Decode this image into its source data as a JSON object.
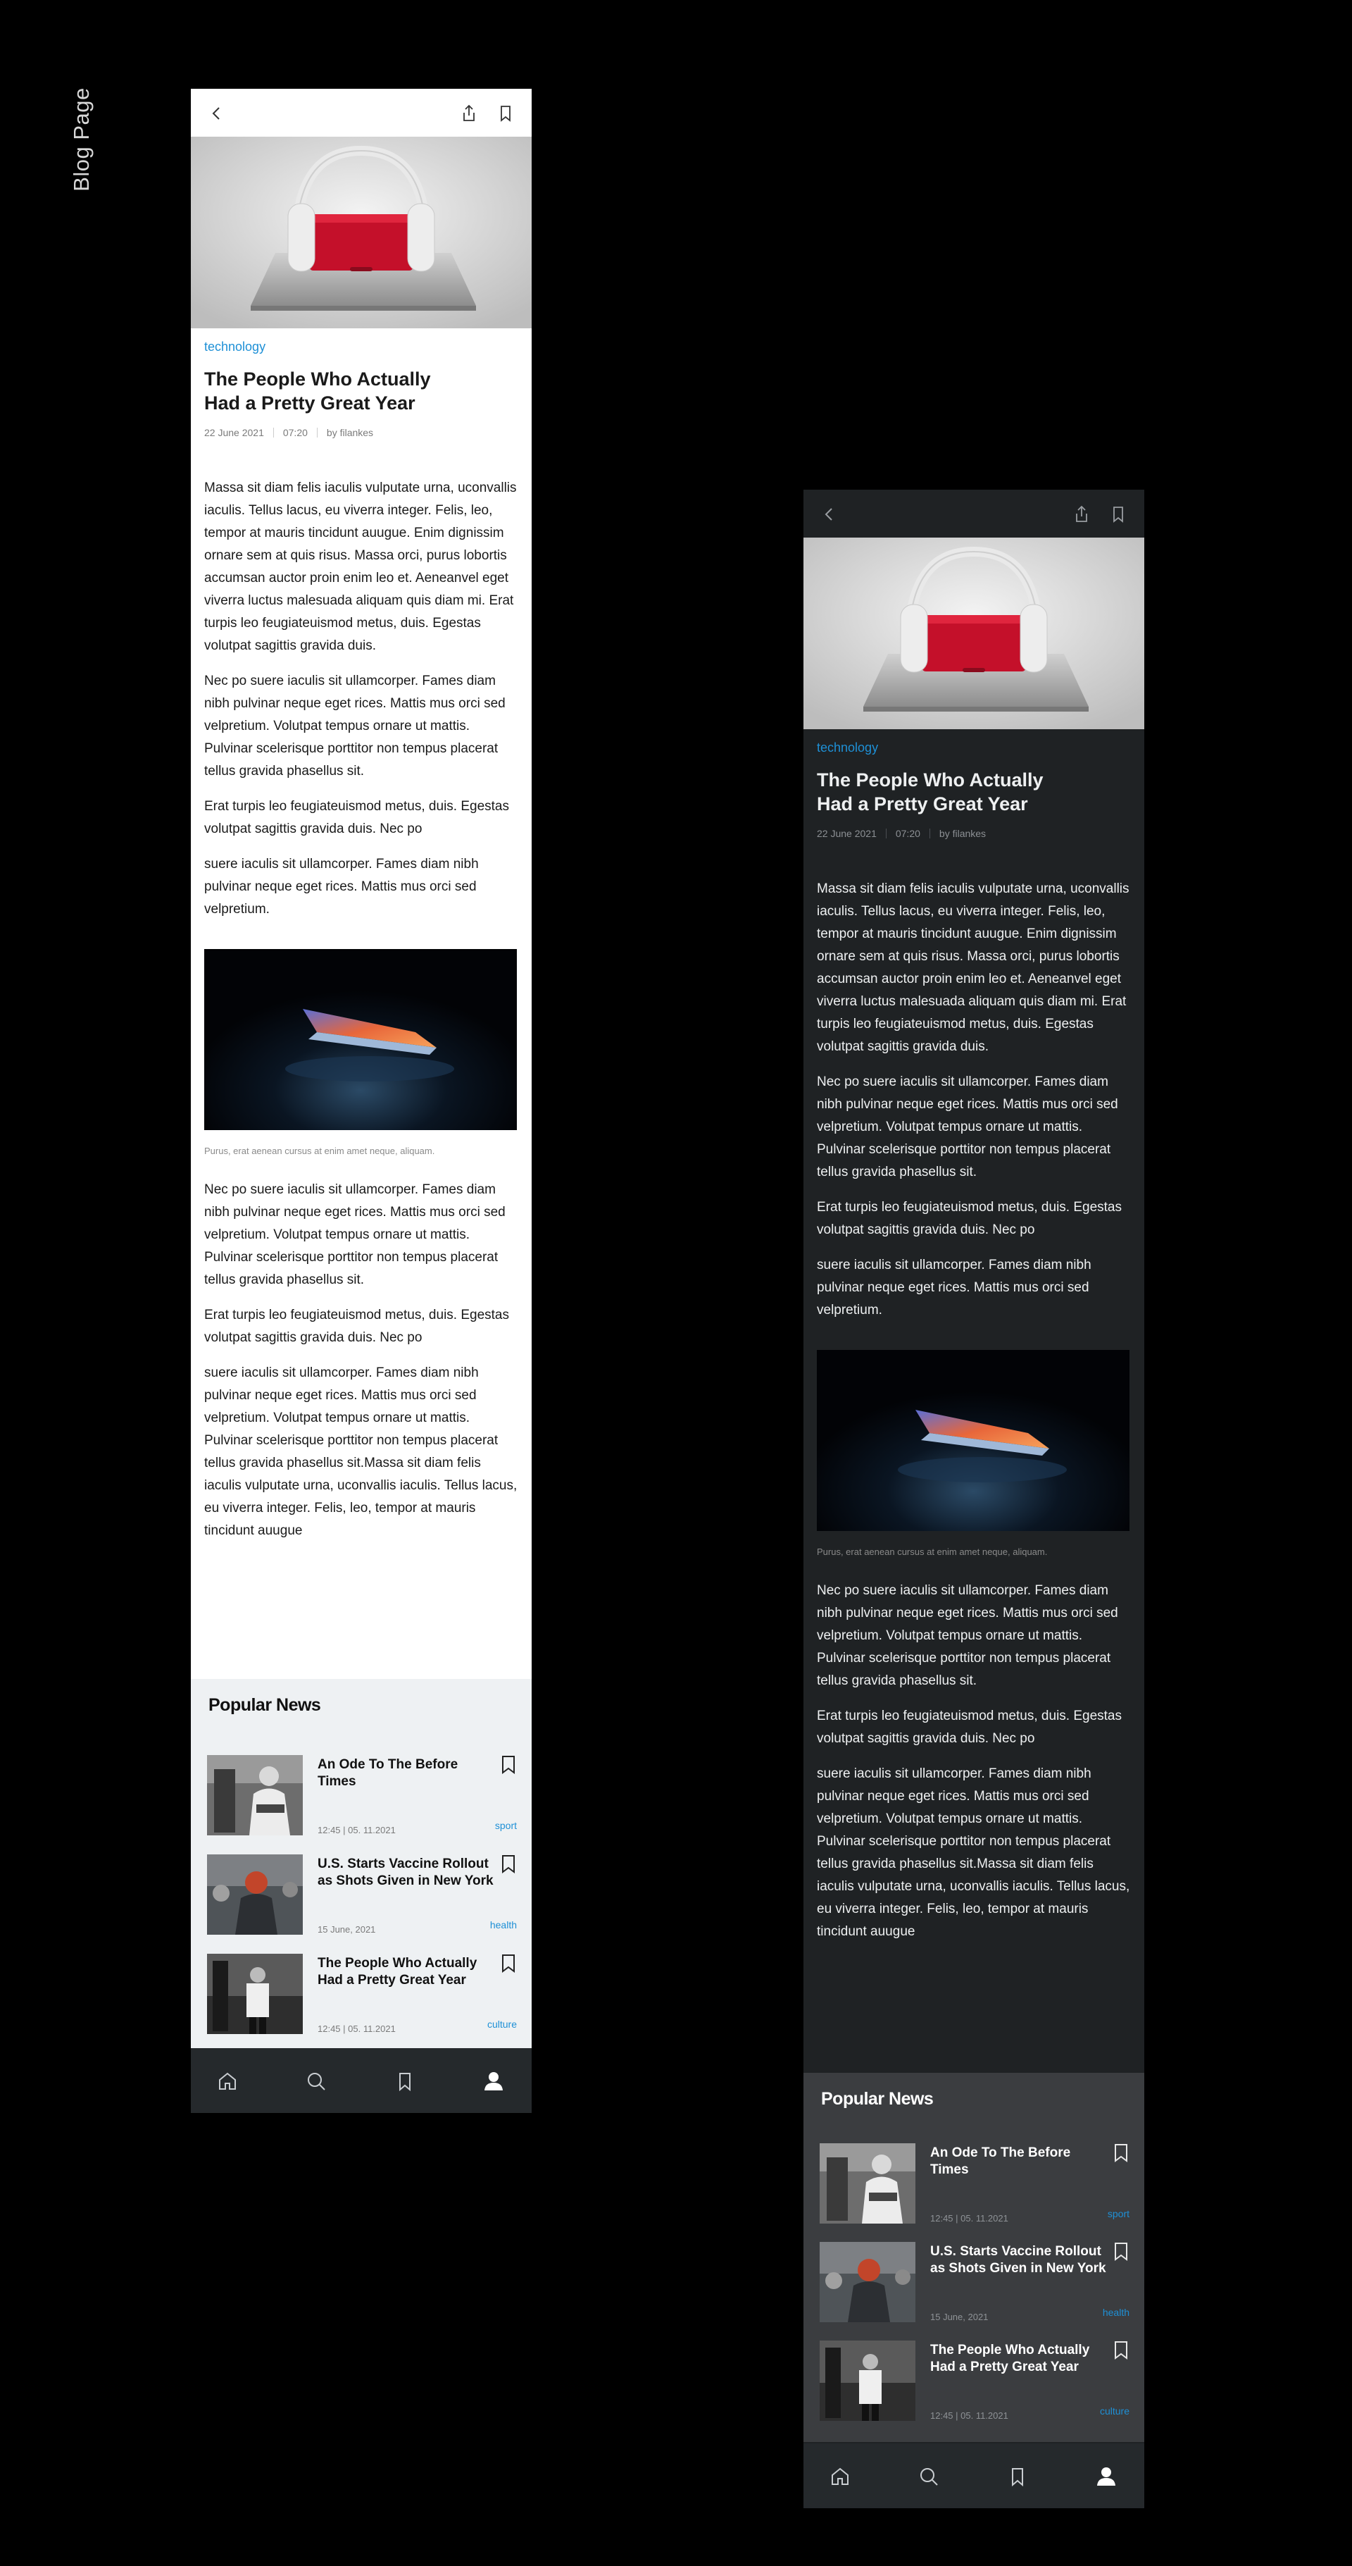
{
  "page_label": "Blog Page",
  "article": {
    "category": "technology",
    "title": "The People Who Actually Had a Pretty Great Year",
    "date": "22 June 2021",
    "time": "07:20",
    "author": "by filankes",
    "paragraphs_before_image": [
      "Massa sit diam felis iaculis vulputate urna, uconvallis iaculis. Tellus lacus, eu viverra integer. Felis, leo, tempor at mauris tincidunt auugue. Enim dignissim ornare sem at quis risus. Massa orci, purus lobortis accumsan auctor proin enim leo et. Aeneanvel eget viverra luctus malesuada aliquam quis diam mi. Erat turpis leo feugiateuismod metus, duis. Egestas volutpat sagittis gravida duis.",
      "Nec po suere iaculis sit ullamcorper. Fames diam nibh pulvinar neque eget rices. Mattis mus orci sed velpretium. Volutpat tempus ornare ut mattis. Pulvinar scelerisque porttitor non tempus placerat tellus gravida phasellus sit.",
      "Erat turpis leo feugiateuismod metus, duis. Egestas volutpat sagittis gravida duis. Nec po",
      "suere iaculis sit ullamcorper. Fames diam nibh pulvinar neque eget rices. Mattis mus orci sed velpretium."
    ],
    "image_caption": "Purus, erat aenean cursus at enim amet neque, aliquam.",
    "paragraphs_after_image": [
      "Nec po suere iaculis sit ullamcorper. Fames diam nibh pulvinar neque eget rices. Mattis mus orci sed velpretium. Volutpat tempus ornare ut mattis. Pulvinar scelerisque porttitor non tempus placerat tellus gravida phasellus sit.",
      "Erat turpis leo feugiateuismod metus, duis. Egestas volutpat sagittis gravida duis. Nec po",
      "suere iaculis sit ullamcorper. Fames diam nibh pulvinar neque eget rices. Mattis mus orci sed velpretium. Volutpat tempus ornare ut mattis. Pulvinar scelerisque porttitor non tempus placerat tellus gravida phasellus sit.Massa sit diam felis iaculis vulputate urna, uconvallis iaculis. Tellus lacus, eu viverra integer. Felis, leo, tempor at mauris tincidunt auugue"
    ]
  },
  "popular": {
    "heading": "Popular News",
    "items": [
      {
        "title": "An Ode To The Before Times",
        "date": "12:45  |  05. 11.2021",
        "tag": "sport"
      },
      {
        "title": "U.S. Starts Vaccine Rollout as Shots Given in New York",
        "date": "15 June, 2021",
        "tag": "health"
      },
      {
        "title": "The People Who Actually Had a Pretty Great Year",
        "date": "12:45  |  05. 11.2021",
        "tag": "culture"
      }
    ]
  },
  "icons": {
    "nav": [
      "chevron-left-icon",
      "share-icon",
      "bookmark-icon"
    ],
    "tabbar": [
      "home-icon",
      "search-icon",
      "bookmark-icon",
      "user-icon"
    ]
  },
  "colors": {
    "accent": "#1e90d6",
    "light_bg": "#ffffff",
    "dark_bg": "#1f2224",
    "tabbar_bg": "#25292c",
    "popular_light_bg": "#eef1f3",
    "popular_dark_bg": "#3b3d40"
  }
}
